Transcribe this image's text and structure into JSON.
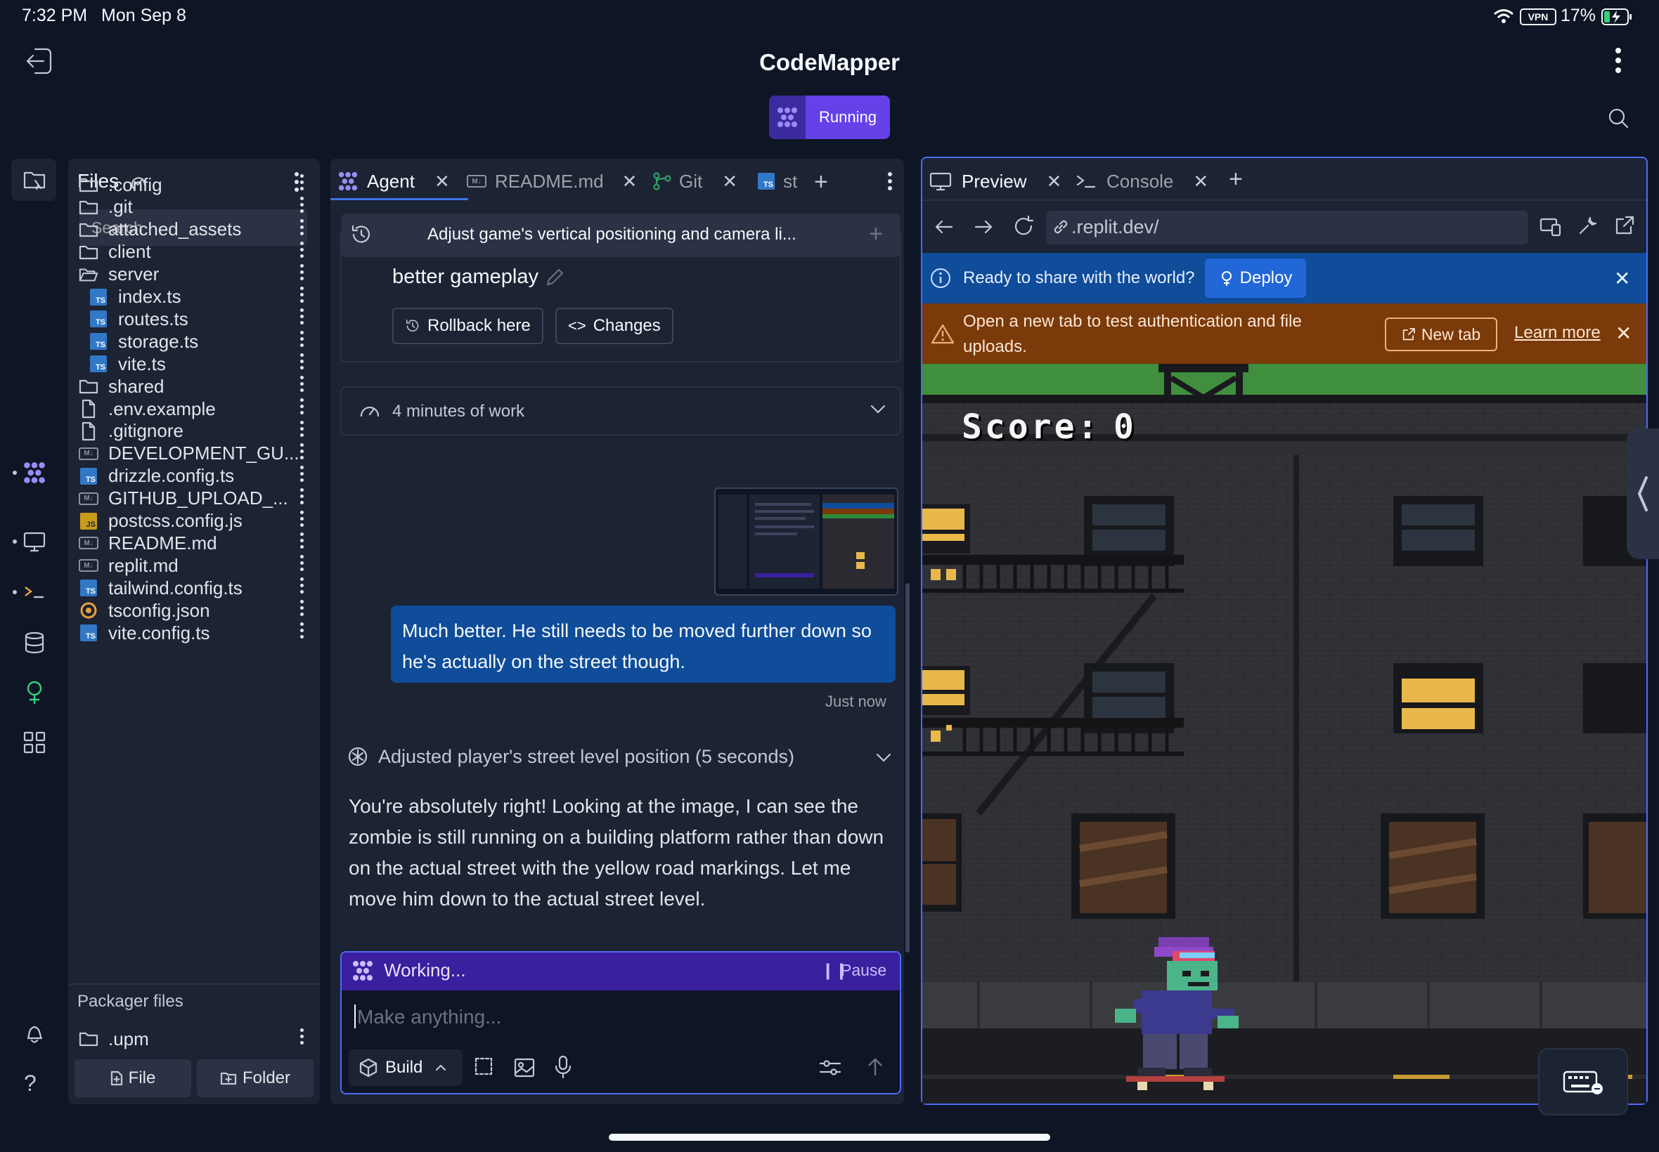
{
  "status_bar": {
    "time": "7:32 PM",
    "date": "Mon Sep 8",
    "vpn": "VPN",
    "battery": "17%"
  },
  "header": {
    "title": "CodeMapper",
    "run_status": "Running"
  },
  "files": {
    "title": "Files",
    "search_placeholder": "Search",
    "items": [
      {
        "name": ".config",
        "type": "folder"
      },
      {
        "name": ".git",
        "type": "folder"
      },
      {
        "name": "attached_assets",
        "type": "folder"
      },
      {
        "name": "client",
        "type": "folder"
      },
      {
        "name": "server",
        "type": "folder-open"
      },
      {
        "name": "index.ts",
        "type": "ts"
      },
      {
        "name": "routes.ts",
        "type": "ts"
      },
      {
        "name": "storage.ts",
        "type": "ts"
      },
      {
        "name": "vite.ts",
        "type": "ts"
      },
      {
        "name": "shared",
        "type": "folder"
      },
      {
        "name": ".env.example",
        "type": "file"
      },
      {
        "name": ".gitignore",
        "type": "file"
      },
      {
        "name": "DEVELOPMENT_GU...",
        "type": "md"
      },
      {
        "name": "drizzle.config.ts",
        "type": "ts"
      },
      {
        "name": "GITHUB_UPLOAD_...",
        "type": "md"
      },
      {
        "name": "postcss.config.js",
        "type": "js"
      },
      {
        "name": "README.md",
        "type": "md"
      },
      {
        "name": "replit.md",
        "type": "md"
      },
      {
        "name": "tailwind.config.ts",
        "type": "ts"
      },
      {
        "name": "tsconfig.json",
        "type": "json"
      },
      {
        "name": "vite.config.ts",
        "type": "ts"
      }
    ],
    "packager_title": "Packager files",
    "packager_items": [
      {
        "name": ".upm",
        "type": "folder"
      }
    ],
    "new_file_label": "File",
    "new_folder_label": "Folder"
  },
  "agent_tabs": [
    {
      "label": "Agent"
    },
    {
      "label": "README.md"
    },
    {
      "label": "Git"
    },
    {
      "label": "st"
    }
  ],
  "agent": {
    "thread_title": "Adjust game's vertical positioning and camera li...",
    "checkpoint_text": "better gameplay",
    "rollback_label": "Rollback here",
    "changes_label": "Changes",
    "work_summary": "4 minutes of work",
    "user_message": "Much better. He still needs to be moved further down so he's actually on the street though.",
    "message_time": "Just now",
    "action_summary": "Adjusted player's street level position (5 seconds)",
    "agent_reply": "You're absolutely right! Looking at the image, I can see the zombie is still running on a building platform rather than down on the actual street with the yellow road markings. Let me move him down to the actual street level.",
    "working_label": "Working...",
    "pause_label": "Pause",
    "input_placeholder": "Make anything...",
    "build_label": "Build"
  },
  "preview_tabs": [
    {
      "label": "Preview"
    },
    {
      "label": "Console"
    }
  ],
  "preview": {
    "url": ".replit.dev/",
    "deploy_prompt": "Ready to share with the world?",
    "deploy_label": "Deploy",
    "warning_text": "Open a new tab to test authentication and file uploads.",
    "new_tab_label": "New tab",
    "learn_more_label": "Learn more",
    "game": {
      "score_label": "Score:",
      "score_value": "0"
    }
  },
  "colors": {
    "background": "#0e1525",
    "panel": "#1c2333",
    "accent": "#6541e8",
    "user_bubble": "#0f4c99",
    "warning": "#7a3a0a",
    "focus_border": "#4c6bf5"
  }
}
